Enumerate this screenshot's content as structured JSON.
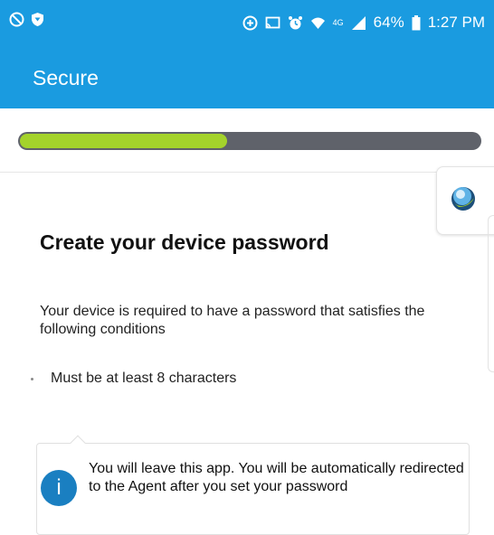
{
  "status_bar": {
    "battery": "64%",
    "time": "1:27 PM",
    "network": "4G",
    "left_icons": [
      "do-not-disturb-icon",
      "shield-icon"
    ],
    "right_icons": [
      "data-saver-icon",
      "cast-icon",
      "alarm-icon",
      "wifi-icon",
      "signal-icon",
      "battery-icon"
    ]
  },
  "app_bar": {
    "title": "Secure",
    "color": "#1a9be0"
  },
  "progress": {
    "fraction": 0.45,
    "fill_color": "#a4d32b",
    "track_color": "#5f626a"
  },
  "agent_tab": {
    "icon": "agent-logo-icon"
  },
  "content": {
    "heading": "Create your device password",
    "description": "Your device is required to have a password that satisfies the following conditions",
    "conditions": [
      "Must be at least 8 characters"
    ]
  },
  "info_card": {
    "icon": "info-icon",
    "icon_glyph": "i",
    "text": "You will leave this app. You will be automatically redirected to the Agent after you set your password"
  }
}
